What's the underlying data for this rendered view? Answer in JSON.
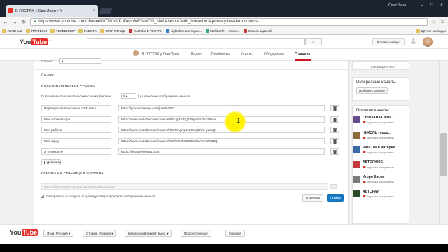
{
  "browser": {
    "tab_title": "В ГОСТЯХ у СветЛаны - Y",
    "window_user": "СветЛана",
    "url": "https://www.youtube.com/channel/UCWmVKnDxpb8WYewD0t_NX8A/about?edit_links=1#c4-primary-header-contents",
    "bookmarks": [
      {
        "label": "ГЛАВНЫЕ",
        "type": "folder"
      },
      {
        "label": "ПЛАТЕЖИ",
        "type": "folder"
      },
      {
        "label": "ТЕЛЕВИЗОР",
        "type": "folder"
      },
      {
        "label": "РАБОТА",
        "type": "folder"
      },
      {
        "label": "ЮПИ-ПРАЙД",
        "type": "folder"
      },
      {
        "label": "YouTube В ГОСТЯХ",
        "type": "site"
      },
      {
        "label": "Lightshot: инструме...",
        "type": "site"
      },
      {
        "label": "MultiSurfer - Advan...",
        "type": "site"
      },
      {
        "label": "Список заданий",
        "type": "site"
      }
    ],
    "bookmarks_other": "Другие закладки"
  },
  "yt": {
    "logo_you": "You",
    "logo_tube": "Tube",
    "logo_region": "UA",
    "upload_label": "Добавить видео"
  },
  "channel_nav": {
    "name": "В ГОСТЯХ у СветЛаны",
    "tabs": [
      "Главная",
      "Видео",
      "Плейлисты",
      "Каналы",
      "Обсуждение",
      "О канале"
    ],
    "active_tab": "О канале"
  },
  "about": {
    "country_label": "Страна:",
    "links_heading": "Ссылки",
    "custom_links_heading": "ПОЛЬЗОВАТЕЛЬСКИЕ ССЫЛКИ",
    "show_links_prefix": "Показывать пользовательские ссылки (первые",
    "show_links_count": "5",
    "show_links_suffix": ") на фоновом изображении канала",
    "links": [
      {
        "title": "Партнерская программа VSP Grou",
        "url": "https://youpartnervsp.com/join?84903"
      },
      {
        "title": "Моя собака Нора",
        "url": "https://www.youtube.com/channel/UCugdznDgZ4VywOs7G-d40cA"
      },
      {
        "title": "Моя работа",
        "url": "https://www.youtube.com/channel/UCOmjV-yXzLOU3jOVU-yddxQ"
      },
      {
        "title": "Мой город",
        "url": "https://www.youtube.com/channel/UCfm3-OCDJOmXaYxV4W013Q"
      },
      {
        "title": "Я в контакте",
        "url": "https://vk.com/sveva31034"
      }
    ],
    "add_label": "Добавить",
    "gplus_heading": "ССЫЛКА НА СТРАНИЦУ В GOOGLE+",
    "gplus_value": "https://plus.google.com/110120551161933018620",
    "overlay_checkbox_label": "Отображать ссылку на +страницу поверх фонового изображения канала",
    "cancel_label": "Отменить",
    "save_label": "Готово"
  },
  "sidebar": {
    "recommended_all": "Просмотреть все",
    "interesting_title": "Интересные каналы",
    "add_channels_label": "Добавить каналы",
    "similar_title": "Похожие каналы",
    "subscribe_label": "Подписка оформлена",
    "similar_channels": [
      {
        "name": "CHINJAHJA Nura -...",
        "color": "#6a4d8c"
      },
      {
        "name": "НИКОЛЬ город...",
        "color": "#8a6a3a"
      },
      {
        "name": "РАБОТА в интерне...",
        "color": "#3a6aa8"
      },
      {
        "name": "АВТОЛЮКС",
        "color": "#c23a3a"
      },
      {
        "name": "Игорь Еясов",
        "color": "#7a7a7a"
      },
      {
        "name": "АВТОРАИ",
        "color": "#2a4a2a"
      }
    ]
  },
  "footer": {
    "language": "Язык: Русский",
    "country": "Страна: Украина",
    "safe_mode": "Безопасный режим: выкл.",
    "history": "Просмотренные",
    "help": "Справка"
  }
}
